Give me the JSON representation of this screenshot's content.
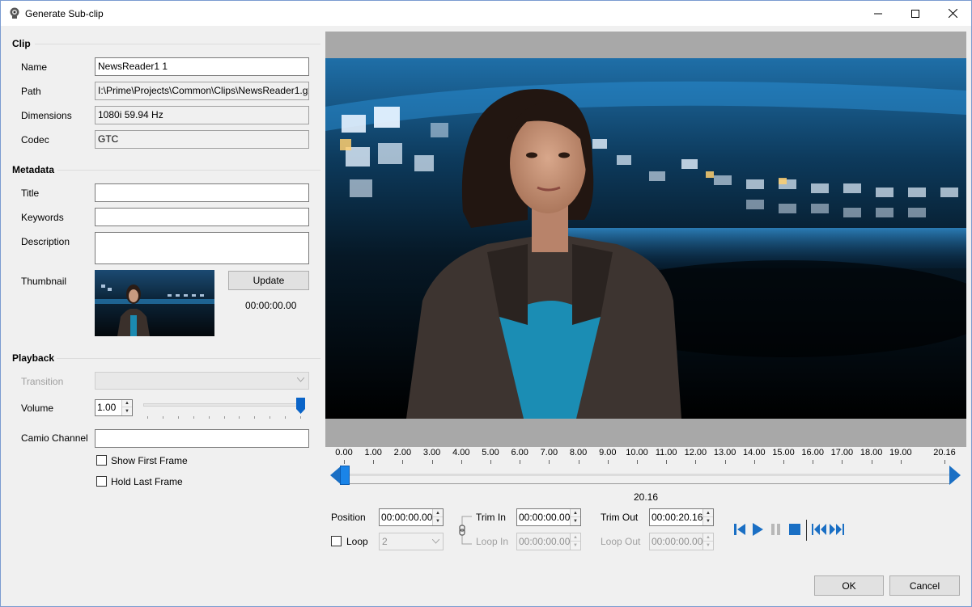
{
  "window": {
    "title": "Generate Sub-clip"
  },
  "clip": {
    "section_label": "Clip",
    "name_label": "Name",
    "name_value": "NewsReader1 1",
    "path_label": "Path",
    "path_value": "I:\\Prime\\Projects\\Common\\Clips\\NewsReader1.gxf",
    "dimensions_label": "Dimensions",
    "dimensions_value": "1080i 59.94 Hz",
    "codec_label": "Codec",
    "codec_value": "GTC"
  },
  "metadata": {
    "section_label": "Metadata",
    "title_label": "Title",
    "title_value": "",
    "keywords_label": "Keywords",
    "keywords_value": "",
    "description_label": "Description",
    "description_value": "",
    "thumbnail_label": "Thumbnail",
    "update_label": "Update",
    "thumbnail_time": "00:00:00.00"
  },
  "playback": {
    "section_label": "Playback",
    "transition_label": "Transition",
    "transition_value": "",
    "volume_label": "Volume",
    "volume_value": "1.00",
    "volume_level": 1.0,
    "camio_label": "Camio Channel",
    "camio_value": "",
    "show_first_frame_label": "Show First Frame",
    "show_first_frame_checked": false,
    "hold_last_frame_label": "Hold Last Frame",
    "hold_last_frame_checked": false
  },
  "timeline": {
    "labels": [
      "0.00",
      "1.00",
      "2.00",
      "3.00",
      "4.00",
      "5.00",
      "6.00",
      "7.00",
      "8.00",
      "9.00",
      "10.00",
      "11.00",
      "12.00",
      "13.00",
      "14.00",
      "15.00",
      "16.00",
      "17.00",
      "18.00",
      "19.00",
      "20.16"
    ],
    "duration_label": "20.16"
  },
  "controls": {
    "position_label": "Position",
    "position_value": "00:00:00.00",
    "loop_label": "Loop",
    "loop_checked": false,
    "loop_count": "2",
    "trim_in_label": "Trim In",
    "trim_in_value": "00:00:00.00",
    "loop_in_label": "Loop In",
    "loop_in_value": "00:00:00.00",
    "trim_out_label": "Trim Out",
    "trim_out_value": "00:00:20.16",
    "loop_out_label": "Loop Out",
    "loop_out_value": "00:00:00.00"
  },
  "transport_icons": [
    "skip-to-start-icon",
    "play-icon",
    "pause-icon",
    "stop-icon",
    "rewind-icon",
    "fast-forward-icon"
  ],
  "footer": {
    "ok_label": "OK",
    "cancel_label": "Cancel"
  },
  "colors": {
    "accent": "#0a64c8",
    "transport": "#1a6fc4"
  }
}
